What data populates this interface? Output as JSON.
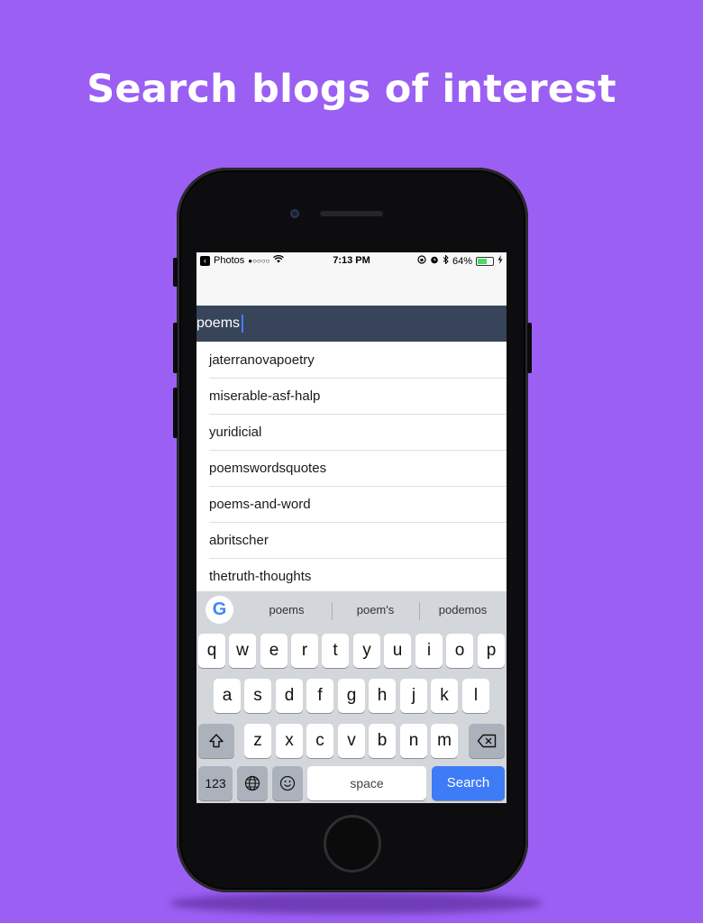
{
  "headline": "Search blogs of interest",
  "status_bar": {
    "back_app": "Photos",
    "signal": "●○○○○",
    "time": "7:13 PM",
    "battery_percent": "64%"
  },
  "search": {
    "query": "poems"
  },
  "results": [
    "jaterranovapoetry",
    "miserable-asf-halp",
    "yuridicial",
    "poemswordsquotes",
    "poems-and-word",
    "abritscher",
    "thetruth-thoughts"
  ],
  "keyboard": {
    "suggestions": [
      "poems",
      "poem's",
      "podemos"
    ],
    "row1": [
      "q",
      "w",
      "e",
      "r",
      "t",
      "y",
      "u",
      "i",
      "o",
      "p"
    ],
    "row2": [
      "a",
      "s",
      "d",
      "f",
      "g",
      "h",
      "j",
      "k",
      "l"
    ],
    "row3": [
      "z",
      "x",
      "c",
      "v",
      "b",
      "n",
      "m"
    ],
    "numbers_label": "123",
    "space_label": "space",
    "search_label": "Search",
    "google_label": "G"
  },
  "colors": {
    "background": "#9b5ff3",
    "searchbar": "#37445a",
    "search_key": "#3e7bf6"
  }
}
